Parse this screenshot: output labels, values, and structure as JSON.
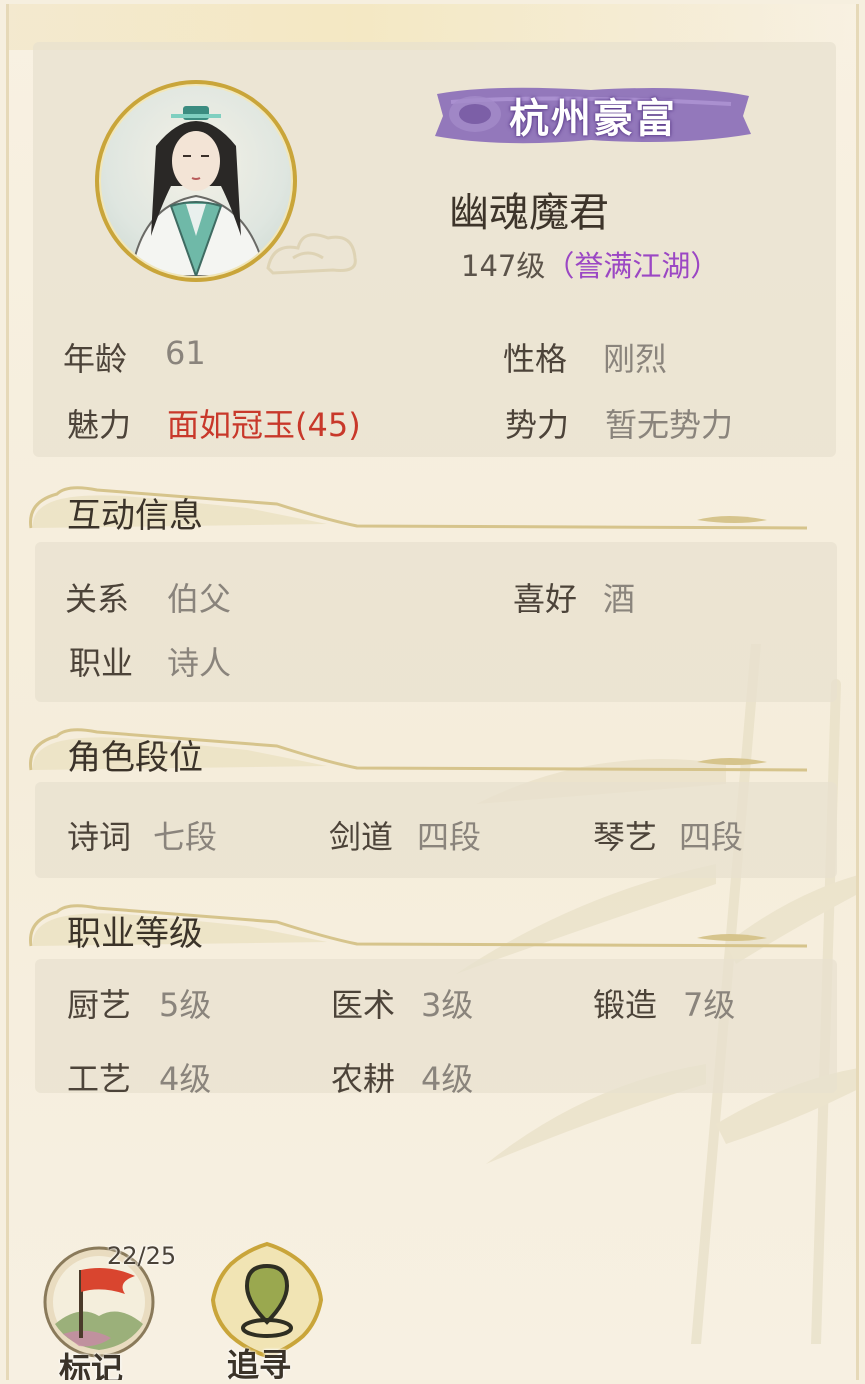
{
  "profile": {
    "title": "杭州豪富",
    "name": "幽魂魔君",
    "level": "147级",
    "reputation": "（誉满江湖）",
    "age_label": "年龄",
    "age_value": "61",
    "personality_label": "性格",
    "personality_value": "刚烈",
    "charm_label": "魅力",
    "charm_value": "面如冠玉(45)",
    "faction_label": "势力",
    "faction_value": "暂无势力"
  },
  "interaction": {
    "header": "互动信息",
    "relation_label": "关系",
    "relation_value": "伯父",
    "hobby_label": "喜好",
    "hobby_value": "酒",
    "job_label": "职业",
    "job_value": "诗人"
  },
  "rank": {
    "header": "角色段位",
    "items": [
      {
        "label": "诗词",
        "value": "七段"
      },
      {
        "label": "剑道",
        "value": "四段"
      },
      {
        "label": "琴艺",
        "value": "四段"
      }
    ]
  },
  "career": {
    "header": "职业等级",
    "items": [
      {
        "label": "厨艺",
        "value": "5级"
      },
      {
        "label": "医术",
        "value": "3级"
      },
      {
        "label": "锻造",
        "value": "7级"
      },
      {
        "label": "工艺",
        "value": "4级"
      },
      {
        "label": "农耕",
        "value": "4级"
      }
    ]
  },
  "actions": {
    "mark_label": "标记",
    "mark_counter": "22/25",
    "track_label": "追寻"
  },
  "colors": {
    "background": "#f6efdf",
    "card": "#e8e0ce",
    "title_banner": "#8a6bb8",
    "reputation": "#9b47c4",
    "charm": "#c8382a",
    "gold_ring": "#c9a53a"
  }
}
